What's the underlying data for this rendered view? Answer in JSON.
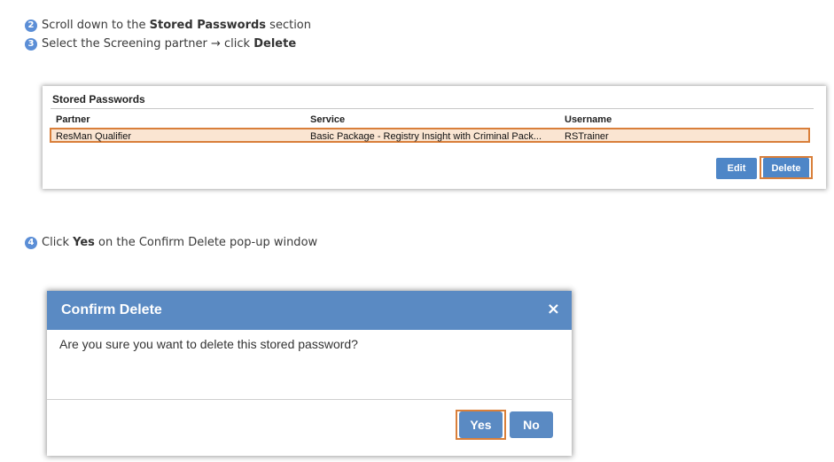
{
  "steps": [
    {
      "num": "2",
      "pre": "Scroll down to the",
      "bold": "Stored Passwords",
      "post": "section"
    },
    {
      "num": "3",
      "pre": "Select the Screening partner → click",
      "bold": "Delete",
      "post": ""
    },
    {
      "num": "4",
      "pre": "Click",
      "bold": "Yes",
      "post": "on the Confirm Delete pop-up window"
    }
  ],
  "stored_passwords": {
    "title": "Stored Passwords",
    "columns": [
      "Partner",
      "Service",
      "Username"
    ],
    "rows": [
      {
        "partner": "ResMan Qualifier",
        "service": "Basic Package - Registry Insight with Criminal Pack...",
        "username": "RSTrainer",
        "selected": true
      }
    ],
    "edit_label": "Edit",
    "delete_label": "Delete"
  },
  "dialog": {
    "title": "Confirm Delete",
    "close_symbol": "×",
    "message": "Are you sure you want to delete this stored password?",
    "yes_label": "Yes",
    "no_label": "No"
  },
  "colors": {
    "accent": "#5a8ac3",
    "highlight_border": "#d97f3a",
    "selected_row": "#fae5d2",
    "step_badge": "#5b8ed6"
  },
  "icons": {
    "close": "close-icon"
  }
}
